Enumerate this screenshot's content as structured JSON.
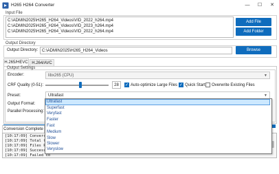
{
  "window": {
    "title": "H265 H264 Converter",
    "controls": [
      "—",
      "☐",
      "✕"
    ]
  },
  "input_file": {
    "group_label": "Input File",
    "files": [
      "C:\\ADMIN2025\\H265_H264_Videos\\VID_2022_h264.mp4",
      "C:\\ADMIN2025\\H265_H264_Videos\\VID_2023_h264.mp4",
      "C:\\ADMIN2025\\H265_H264_Videos\\VID_2022_h264.mp4"
    ],
    "add_file_label": "Add File",
    "add_folder_label": "Add Folder"
  },
  "output_directory": {
    "group_label": "Output Directory",
    "field_label": "Output Directory:",
    "value": "C:\\ADMIN2025\\H265_H264_Videos",
    "browse_label": "Browse"
  },
  "tabs": [
    {
      "label": "H.265/HEVC",
      "active": true
    },
    {
      "label": "H.264/AVC",
      "active": false
    }
  ],
  "output_settings": {
    "group_label": "Output Settings",
    "encoder_label": "Encoder:",
    "encoder_value": "libx265 (CPU)",
    "crf_label": "CRF Quality (0-51):",
    "crf_value": "28",
    "crf_fraction": 0.55,
    "auto_optimize_label": "Auto-optimize Large Files",
    "auto_optimize_checked": true,
    "quick_start_label": "Quick Start",
    "quick_start_checked": true,
    "overwrite_label": "Overwrite Existing Files",
    "overwrite_checked": false,
    "preset_label": "Preset:",
    "preset_value": "Ultrafast",
    "output_format_label": "Output Format:",
    "parallel_label": "Parallel Processing:",
    "preset_options": [
      "Ultrafast",
      "Superfast",
      "Veryfast",
      "Faster",
      "Fast",
      "Medium",
      "Slow",
      "Slower",
      "Veryslow"
    ]
  },
  "status": {
    "tab_label": "Conversion Complete"
  },
  "log": {
    "lines": [
      "[10:17:09] Conversio",
      "[10:17:09] Total fil",
      "[10:17:09] Files Pro",
      "[10:17:09] Successfu",
      "[10:17:09] Failed co"
    ]
  },
  "colors": {
    "accent": "#0f6cbd",
    "dropdown_highlight": "#cce8ff"
  }
}
